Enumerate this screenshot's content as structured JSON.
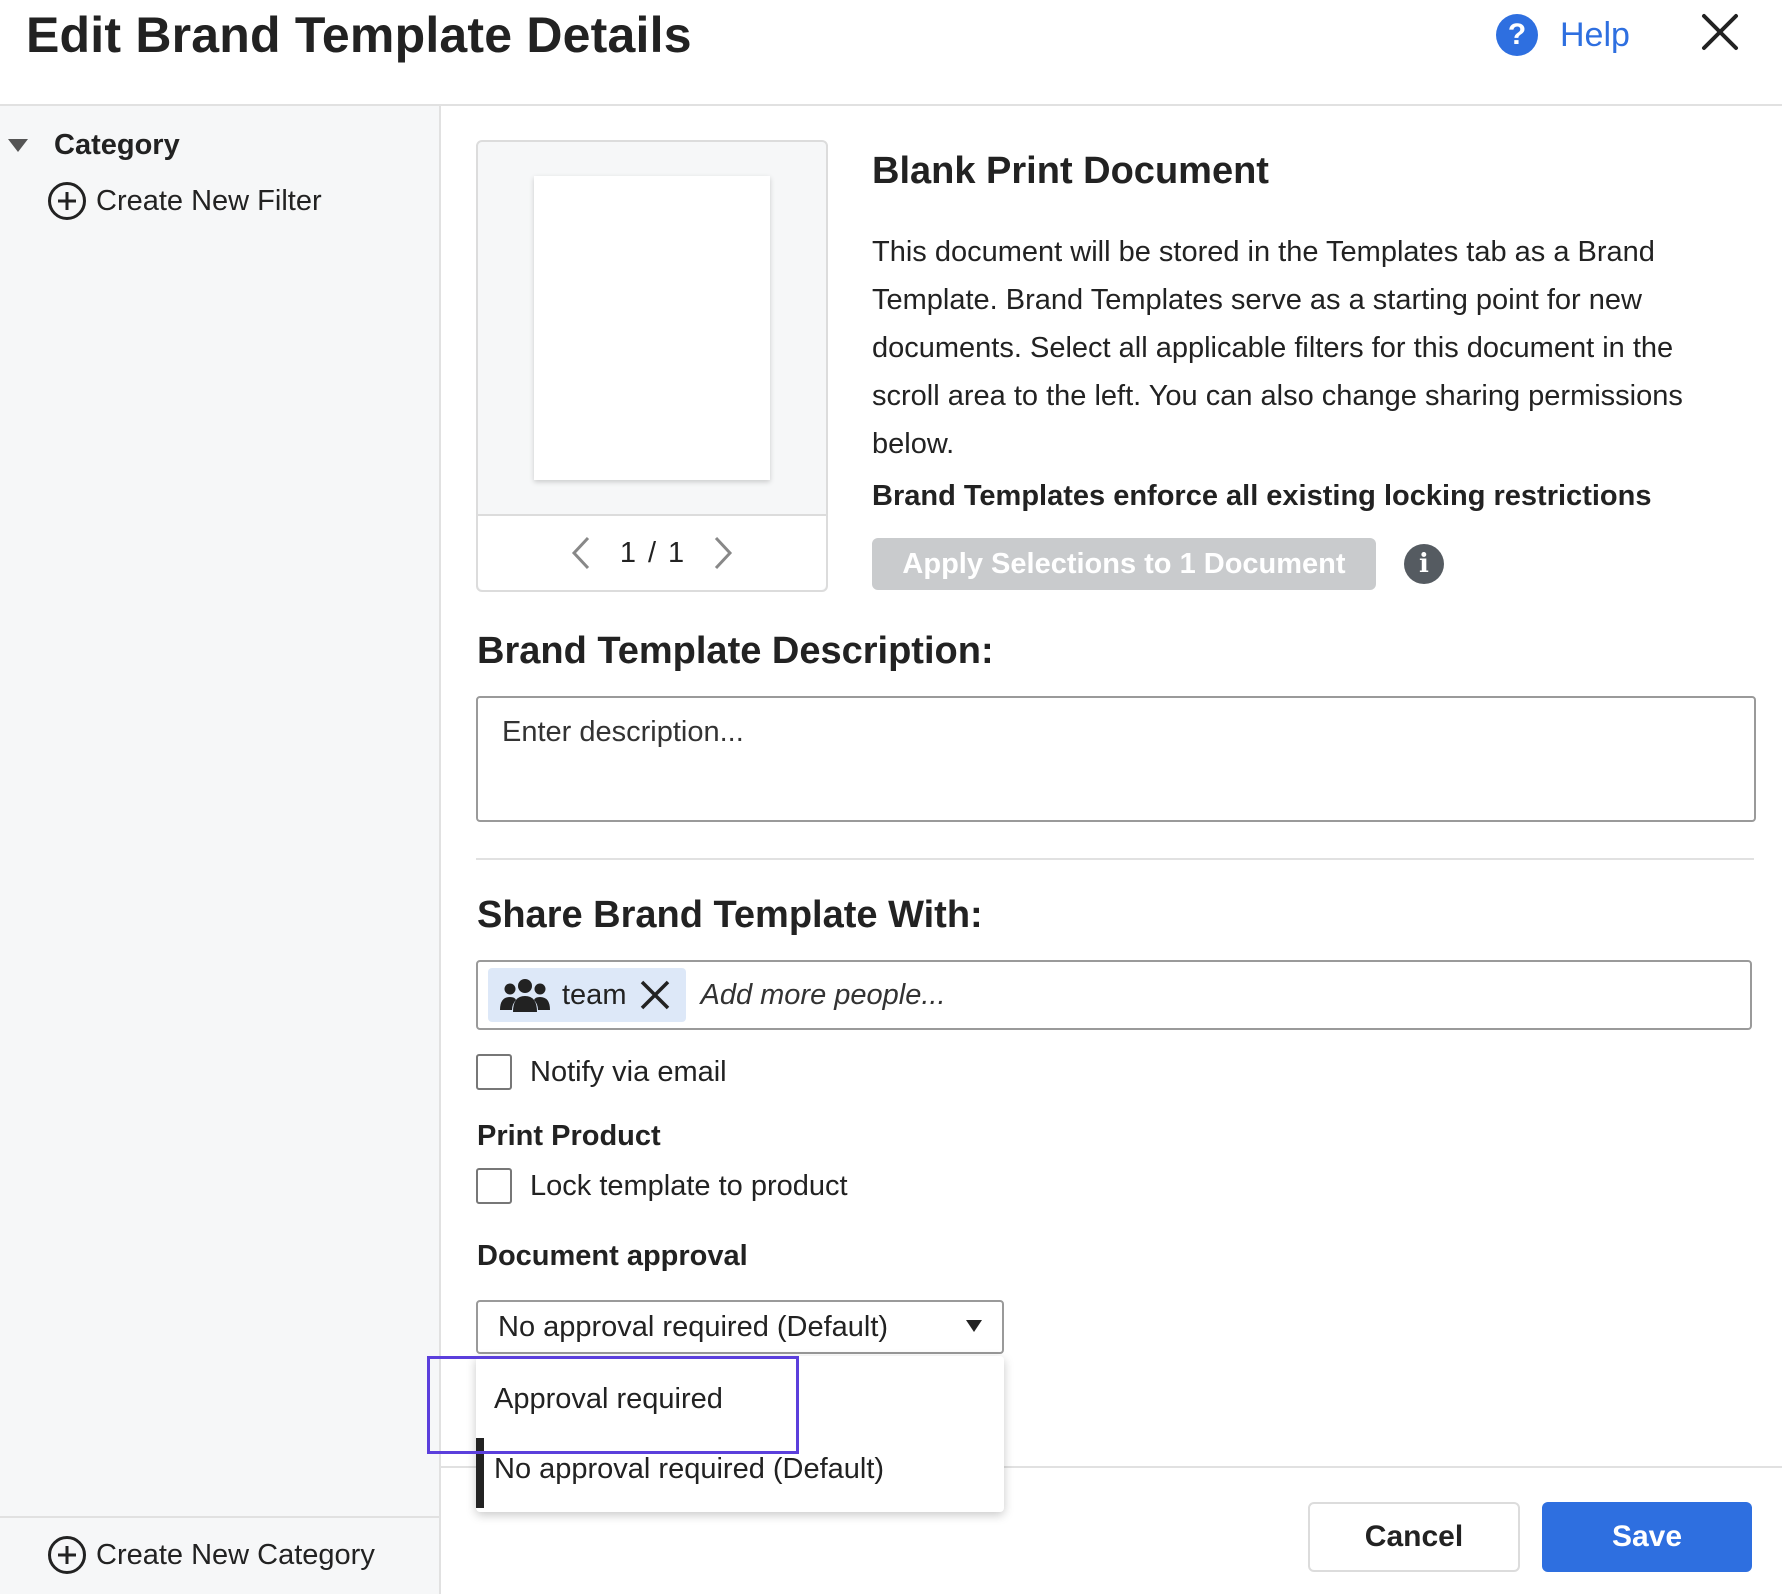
{
  "header": {
    "title": "Edit Brand Template Details",
    "help_label": "Help",
    "help_icon_glyph": "?",
    "help_icon": "question-circle-icon",
    "close_icon": "close-icon"
  },
  "sidebar": {
    "category_label": "Category",
    "create_filter_label": "Create New Filter",
    "create_category_label": "Create New Category"
  },
  "preview": {
    "page_current": "1",
    "page_separator": "/",
    "page_total": "1"
  },
  "document": {
    "title": "Blank Print Document",
    "description": "This document will be stored in the Templates tab as a Brand Template. Brand Templates serve as a starting point for new documents. Select all applicable filters for this document in the scroll area to the left. You can also change sharing permissions below.",
    "lock_note": "Brand Templates enforce all existing locking restrictions",
    "apply_button_label": "Apply Selections to 1 Document",
    "info_icon_glyph": "i"
  },
  "description_section": {
    "heading": "Brand Template Description:",
    "placeholder": "Enter description..."
  },
  "share_section": {
    "heading": "Share Brand Template With:",
    "chips": [
      {
        "label": "team",
        "icon": "people-icon"
      }
    ],
    "placeholder": "Add more people...",
    "notify_label": "Notify via email",
    "notify_checked": false
  },
  "print_product": {
    "heading": "Print Product",
    "lock_label": "Lock template to product",
    "lock_checked": false
  },
  "approval": {
    "heading": "Document approval",
    "selected_value": "No approval required (Default)",
    "options": [
      "Approval required",
      "No approval required (Default)"
    ]
  },
  "footer": {
    "cancel_label": "Cancel",
    "save_label": "Save"
  },
  "colors": {
    "accent": "#2e6fe0",
    "highlight": "#5b3fdc",
    "chip_bg": "#dde8f8",
    "disabled_button": "#c9cbcd"
  }
}
